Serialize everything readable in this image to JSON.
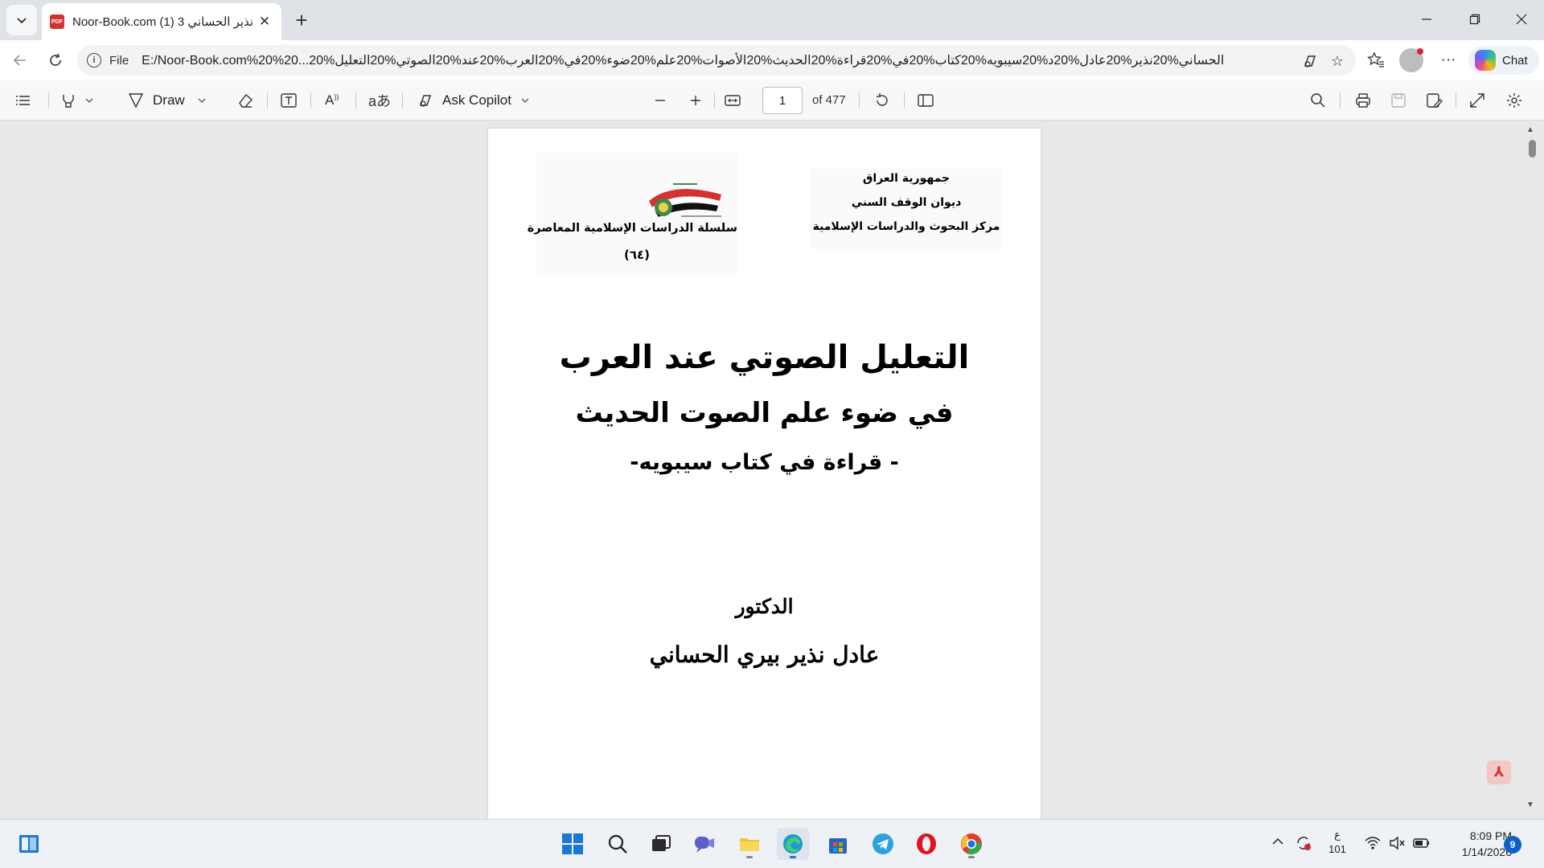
{
  "browser": {
    "tab": {
      "title": "Noor-Book.com (1) 3 نذير الحساني",
      "favicon": "PDF"
    },
    "address": {
      "scheme": "File",
      "url": "E:/Noor-Book.com%20%20...20%الحساني%20نذير%20عادل%20د%20سيبويه%20كتاب%20في%20قراءة%20الحديث%20الأصوات%20علم%20ضوء%20في%20العرب%20عند%20الصوتي%20التعليل"
    },
    "chat_label": "Chat"
  },
  "pdf_toolbar": {
    "draw_label": "Draw",
    "copilot_label": "Ask Copilot",
    "page_current": "1",
    "page_total": "of 477"
  },
  "document": {
    "org_lines": [
      "جمهورية العراق",
      "ديوان الوقف السني",
      "مركز البحوث والدراسات الإسلامية"
    ],
    "series_name": "سلسلة الدراسات الإسلامية المعاصرة",
    "series_number": "(٦٤)",
    "title_line1": "التعليل الصوتي عند العرب",
    "title_line2": "في ضوء علم الصوت الحديث",
    "title_line3": "- قراءة في كتاب سيبويه-",
    "author_title": "الدكتور",
    "author_name": "عادل نذير بيري الحساني"
  },
  "taskbar": {
    "tray_lang": "ع",
    "tray_lang_code": "101",
    "time": "8:09 PM",
    "date": "1/14/2026",
    "notifications": "9"
  },
  "colors": {
    "accent": "#0f5fc4",
    "pdf_red": "#d4322f"
  }
}
